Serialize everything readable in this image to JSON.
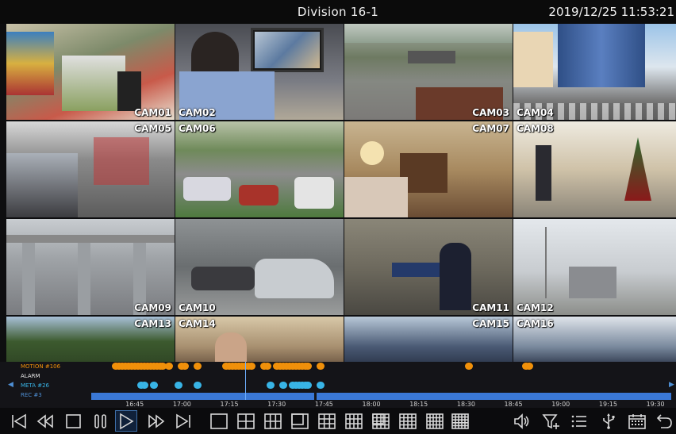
{
  "header": {
    "title": "Division 16-1",
    "datetime": "2019/12/25 11:53:21"
  },
  "cameras": [
    {
      "label": "CAM01"
    },
    {
      "label": "CAM02"
    },
    {
      "label": "CAM03"
    },
    {
      "label": "CAM04"
    },
    {
      "label": "CAM05"
    },
    {
      "label": "CAM06"
    },
    {
      "label": "CAM07"
    },
    {
      "label": "CAM08"
    },
    {
      "label": "CAM09"
    },
    {
      "label": "CAM10"
    },
    {
      "label": "CAM11"
    },
    {
      "label": "CAM12"
    },
    {
      "label": "CAM13"
    },
    {
      "label": "CAM14"
    },
    {
      "label": "CAM15"
    },
    {
      "label": "CAM16"
    }
  ],
  "timeline": {
    "rows": [
      {
        "label": "MOTION #106",
        "color": "#f0900a"
      },
      {
        "label": "ALARM",
        "color": "#e6e6e6"
      },
      {
        "label": "META #26",
        "color": "#38b4e6"
      },
      {
        "label": "REC #3",
        "color": "#3a78d6"
      }
    ],
    "ticks": [
      "16:45",
      "17:00",
      "17:15",
      "17:30",
      "17:45",
      "18:00",
      "18:15",
      "18:30",
      "18:45",
      "19:00",
      "19:15",
      "19:30"
    ],
    "start_time": "16:30",
    "end_time": "19:35",
    "cursor_time": "17:20",
    "motion_events": [
      "16:39",
      "16:40",
      "16:41",
      "16:42",
      "16:43",
      "16:44",
      "16:45",
      "16:46",
      "16:47",
      "16:48",
      "16:49",
      "16:50",
      "16:51",
      "16:52",
      "16:53",
      "16:54",
      "16:56",
      "17:00",
      "17:01",
      "17:05",
      "17:14",
      "17:15",
      "17:16",
      "17:17",
      "17:18",
      "17:19",
      "17:20",
      "17:21",
      "17:22",
      "17:26",
      "17:27",
      "17:30",
      "17:31",
      "17:32",
      "17:33",
      "17:34",
      "17:35",
      "17:36",
      "17:37",
      "17:38",
      "17:39",
      "17:40",
      "17:44",
      "18:31",
      "18:49",
      "18:50"
    ],
    "meta_events": [
      "16:47",
      "16:48",
      "16:51",
      "16:59",
      "17:05",
      "17:28",
      "17:32",
      "17:35",
      "17:36",
      "17:37",
      "17:38",
      "17:39",
      "17:40",
      "17:44"
    ],
    "rec_gap_time": "17:42"
  },
  "toolbar": {
    "buttons": [
      {
        "name": "step-back-button",
        "icon": "step-back-icon"
      },
      {
        "name": "rewind-button",
        "icon": "rewind-icon"
      },
      {
        "name": "stop-button",
        "icon": "stop-icon"
      },
      {
        "name": "pause-button",
        "icon": "pause-icon"
      },
      {
        "name": "play-button",
        "icon": "play-icon",
        "active": true
      },
      {
        "name": "fast-forward-button",
        "icon": "fast-forward-icon"
      },
      {
        "name": "step-forward-button",
        "icon": "step-forward-icon"
      },
      {
        "name": "layout-1-button",
        "icon": "layout-1-icon"
      },
      {
        "name": "layout-4-button",
        "icon": "layout-4-icon"
      },
      {
        "name": "layout-6-button",
        "icon": "layout-6-icon"
      },
      {
        "name": "layout-8-button",
        "icon": "layout-8-icon"
      },
      {
        "name": "layout-9-button",
        "icon": "layout-9-icon"
      },
      {
        "name": "layout-12-button",
        "icon": "layout-12-icon"
      },
      {
        "name": "layout-13-button",
        "icon": "layout-13-icon"
      },
      {
        "name": "layout-16-button",
        "icon": "layout-16-icon"
      },
      {
        "name": "layout-20-button",
        "icon": "layout-20-icon"
      },
      {
        "name": "layout-25-button",
        "icon": "layout-25-icon"
      },
      {
        "name": "audio-button",
        "icon": "speaker-icon"
      },
      {
        "name": "filter-button",
        "icon": "filter-icon"
      },
      {
        "name": "list-button",
        "icon": "list-icon"
      },
      {
        "name": "usb-button",
        "icon": "usb-icon"
      },
      {
        "name": "calendar-button",
        "icon": "calendar-icon"
      },
      {
        "name": "back-button",
        "icon": "return-icon"
      }
    ]
  }
}
